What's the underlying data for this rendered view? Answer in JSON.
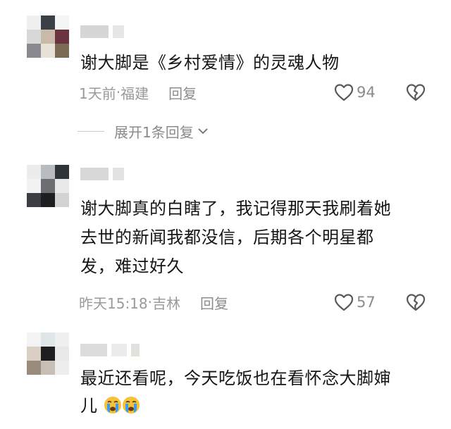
{
  "comments": [
    {
      "text": "谢大脚是《乡村爱情》的灵魂人物",
      "time": "1天前",
      "location": "福建",
      "reply_label": "回复",
      "likes": "94",
      "replies_expand_label": "展开1条回复"
    },
    {
      "text_line1": "谢大脚真的白瞎了，我记得那天我刷着她",
      "text_line2": "去世的新闻我都没信，后期各个明星都",
      "text_line3": "发，难过好久",
      "time": "昨天15:18",
      "location": "吉林",
      "reply_label": "回复",
      "likes": "57"
    },
    {
      "text_line1": "最近还看呢，今天吃饭也在看怀念大脚婶",
      "text_line2": "儿",
      "emojis": [
        "crying-face-icon",
        "crying-face-icon"
      ]
    }
  ],
  "meta_separator": " · ",
  "colors": {
    "text": "#151515",
    "meta": "#9a9a9a",
    "icon_stroke": "#5a5a5a",
    "emoji_face": "#f6c23a",
    "emoji_tears": "#3b9cf0"
  }
}
